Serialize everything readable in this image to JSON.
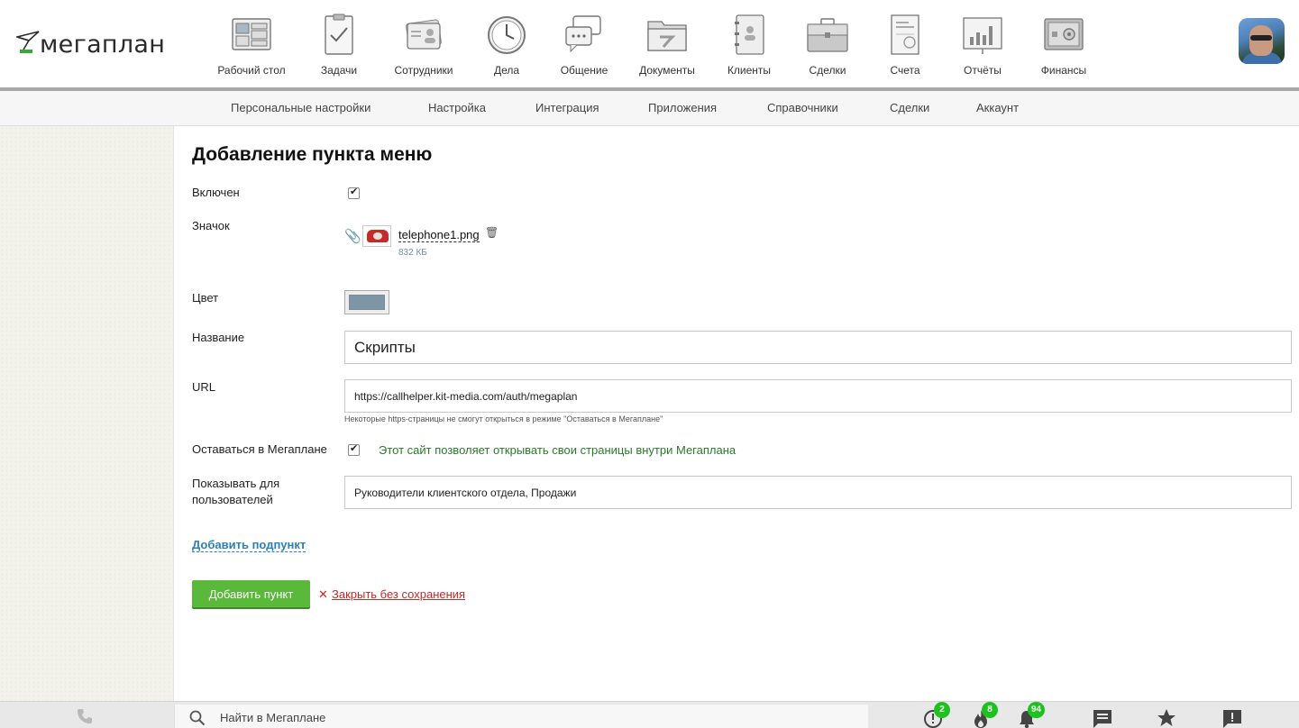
{
  "app": {
    "logo_text": "мегаплан"
  },
  "nav": {
    "items": [
      {
        "label": "Рабочий стол",
        "icon": "desktop-icon"
      },
      {
        "label": "Задачи",
        "icon": "tasks-icon"
      },
      {
        "label": "Сотрудники",
        "icon": "employees-icon"
      },
      {
        "label": "Дела",
        "icon": "clock-icon"
      },
      {
        "label": "Общение",
        "icon": "chat-icon"
      },
      {
        "label": "Документы",
        "icon": "folder-icon"
      },
      {
        "label": "Клиенты",
        "icon": "clients-icon"
      },
      {
        "label": "Сделки",
        "icon": "briefcase-icon"
      },
      {
        "label": "Счета",
        "icon": "invoice-icon"
      },
      {
        "label": "Отчёты",
        "icon": "reports-icon"
      },
      {
        "label": "Финансы",
        "icon": "safe-icon"
      }
    ]
  },
  "subnav": {
    "items": [
      "Персональные настройки",
      "Настройка",
      "Интеграция",
      "Приложения",
      "Справочники",
      "Сделки",
      "Аккаунт"
    ]
  },
  "form": {
    "title": "Добавление пункта меню",
    "enabled_label": "Включен",
    "enabled": true,
    "icon_label": "Значок",
    "file_name": "telephone1.png",
    "file_size": "832 КБ",
    "color_label": "Цвет",
    "color_value": "#7e95a6",
    "name_label": "Название",
    "name_value": "Скрипты",
    "url_label": "URL",
    "url_value": "https://callhelper.kit-media.com/auth/megaplan",
    "url_hint": "Некоторые https-страницы не смогут открыться в режиме \"Оставаться в Мегаплане\"",
    "stay_label": "Оставаться в Мегаплане",
    "stay_enabled": true,
    "stay_message": "Этот сайт позволяет открывать свои страницы внутри Мегаплана",
    "users_label_line1": "Показывать для",
    "users_label_line2": "пользователей",
    "users_value": "Руководители клиентского отдела, Продажи",
    "add_subitem_link": "Добавить подпункт",
    "submit_button": "Добавить пункт",
    "close_link": "Закрыть без сохранения"
  },
  "bottombar": {
    "search_placeholder": "Найти в Мегаплане",
    "badges": {
      "alerts": "2",
      "hot": "8",
      "notifications": "94"
    }
  },
  "colors": {
    "accent_green": "#5ab83b",
    "link_blue": "#2c7fb8",
    "danger_red": "#c62828",
    "badge_green": "#1ec21e"
  }
}
